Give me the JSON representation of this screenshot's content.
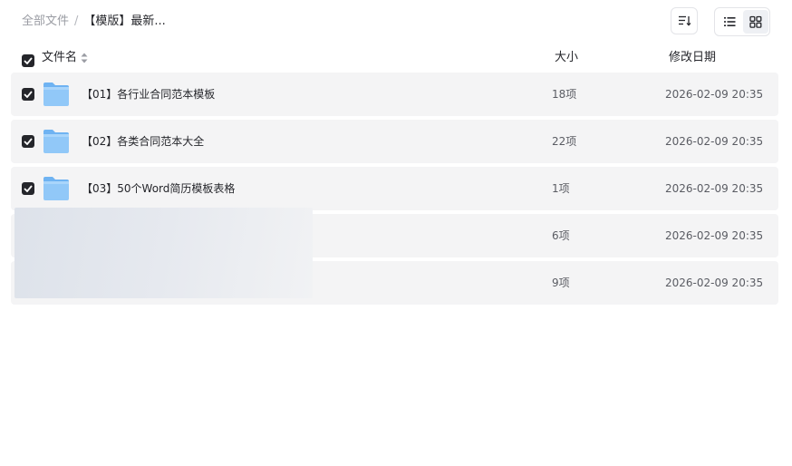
{
  "breadcrumb": {
    "root": "全部文件",
    "separator": "/",
    "current": "【模版】最新..."
  },
  "toolbar": {
    "sort_icon": "sort-icon",
    "list_view_icon": "list-view-icon",
    "grid_view_icon": "grid-view-icon",
    "active_view": "grid"
  },
  "header": {
    "name": "文件名",
    "size": "大小",
    "date": "修改日期",
    "select_all_checked": true
  },
  "files": [
    {
      "name": "【01】各行业合同范本模板",
      "size": "18项",
      "date": "2026-02-09 20:35",
      "checked": true,
      "type": "folder"
    },
    {
      "name": "【02】各类合同范本大全",
      "size": "22项",
      "date": "2026-02-09 20:35",
      "checked": true,
      "type": "folder"
    },
    {
      "name": "【03】50个Word简历模板表格",
      "size": "1项",
      "date": "2026-02-09 20:35",
      "checked": true,
      "type": "folder"
    },
    {
      "name": "",
      "size": "6项",
      "date": "2026-02-09 20:35",
      "checked": false,
      "type": "obscured"
    },
    {
      "name": "",
      "size": "9项",
      "date": "2026-02-09 20:35",
      "checked": false,
      "type": "obscured"
    }
  ],
  "colors": {
    "row_bg": "#f4f4f5",
    "checkbox": "#25262b",
    "folder": "#8fc6f7"
  }
}
